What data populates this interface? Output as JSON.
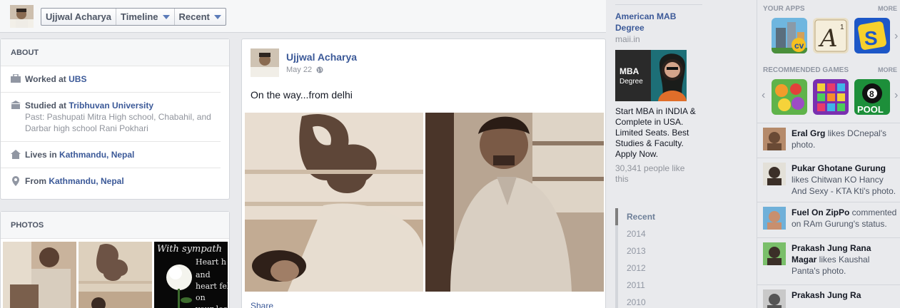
{
  "header": {
    "profile_name": "Ujjwal Acharya",
    "crumb_timeline": "Timeline",
    "crumb_recent": "Recent"
  },
  "about": {
    "title": "ABOUT",
    "work_prefix": "Worked at ",
    "work_place": "UBS",
    "study_prefix": "Studied at ",
    "study_place": "Tribhuvan University",
    "study_past": "Past: Pashupati Mitra High school, Chabahil, and Darbar high school Rani Pokhari",
    "lives_prefix": "Lives in ",
    "lives_place": "Kathmandu, Nepal",
    "from_prefix": "From ",
    "from_place": "Kathmandu, Nepal"
  },
  "photos": {
    "title": "PHOTOS",
    "thumb3_text": "With sympath Heart h and heart fel on your los"
  },
  "post": {
    "author": "Ujjwal Acharya",
    "date": "May 22",
    "text": "On the way...from delhi",
    "share": "Share"
  },
  "ad": {
    "title": "American MAB Degree",
    "domain": "maii.in",
    "image_caption": "MBA Degree",
    "body": "Start MBA in INDIA & Complete in USA. Limited Seats. Best Studies & Faculty. Apply Now.",
    "likes": "30,341 people like this"
  },
  "years": [
    "Recent",
    "2014",
    "2013",
    "2012",
    "2011",
    "2010"
  ],
  "sidebar": {
    "your_apps": "YOUR APPS",
    "more": "MORE",
    "recommended_games": "RECOMMENDED GAMES",
    "more2": "MORE",
    "game_pool_label": "POOL",
    "game_pool_number": "8",
    "app2_letter": "A",
    "app2_sup": "1",
    "app3_letter": "S"
  },
  "ticker": [
    {
      "name": "Eral Grg",
      "action": " likes DCnepal's photo."
    },
    {
      "name": "Pukar Ghotane Gurung",
      "action": " likes Chitwan KO Hancy And Sexy - KTA Kti's photo."
    },
    {
      "name": "Fuel On ZipPo",
      "action": " commented on RAm Gurung's status."
    },
    {
      "name": "Prakash Jung Rana Magar",
      "action": " likes Kaushal Panta's photo."
    },
    {
      "name": "Prakash Jung Ra",
      "action": ""
    }
  ],
  "colors": {
    "brand_blue": "#3b5998",
    "background": "#e9eaed"
  }
}
